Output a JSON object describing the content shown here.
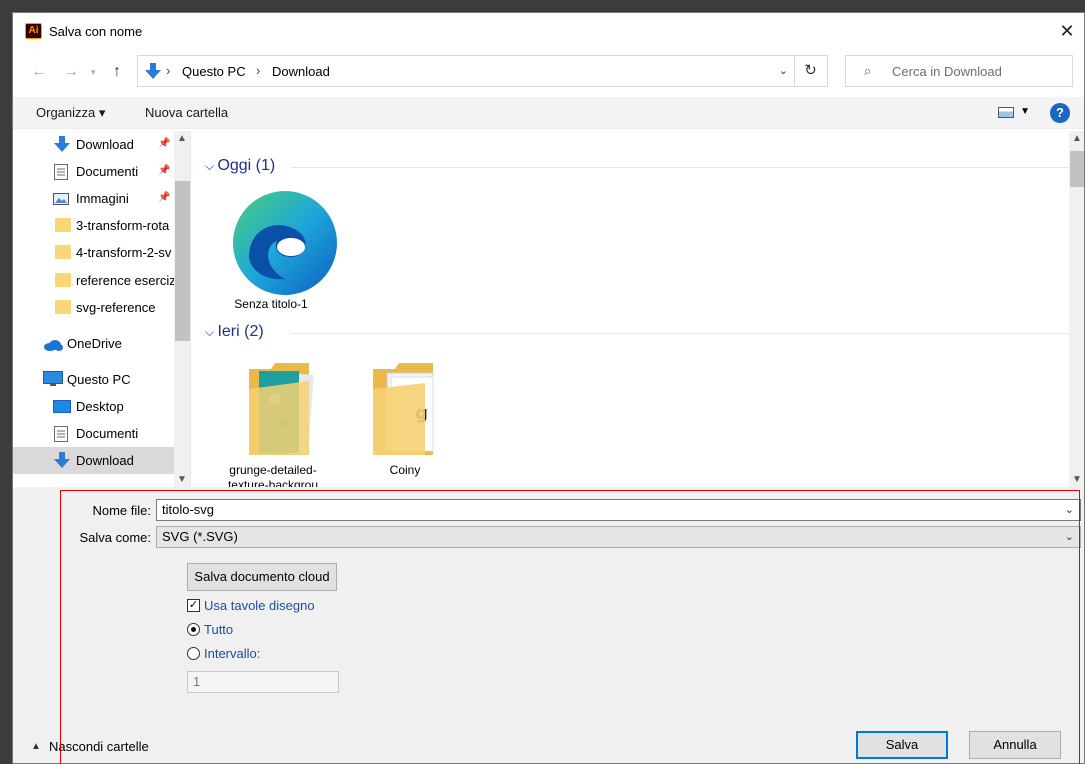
{
  "window": {
    "app_logo": "Ai",
    "title": "Salva con nome",
    "close_symbol": "✕"
  },
  "address": {
    "crumbs": [
      "Questo PC",
      "Download"
    ],
    "search_placeholder": "Cerca in Download"
  },
  "toolbar": {
    "organize": "Organizza ▾",
    "new_folder": "Nuova cartella",
    "help_symbol": "?"
  },
  "sidebar": {
    "items": [
      {
        "label": "Download",
        "icon": "download-arrow-icon",
        "pinned": true
      },
      {
        "label": "Documenti",
        "icon": "document-icon",
        "pinned": true
      },
      {
        "label": "Immagini",
        "icon": "pictures-icon",
        "pinned": true
      },
      {
        "label": "3-transform-rota",
        "icon": "folder-icon"
      },
      {
        "label": "4-transform-2-sv",
        "icon": "folder-icon"
      },
      {
        "label": "reference esercizi",
        "icon": "folder-icon"
      },
      {
        "label": "svg-reference",
        "icon": "folder-icon"
      },
      {
        "label": "OneDrive",
        "icon": "cloud-icon"
      },
      {
        "label": "Questo PC",
        "icon": "computer-icon"
      },
      {
        "label": "Desktop",
        "icon": "desktop-icon"
      },
      {
        "label": "Documenti",
        "icon": "document-icon"
      },
      {
        "label": "Download",
        "icon": "download-arrow-icon",
        "selected": true
      }
    ]
  },
  "content": {
    "groups": [
      {
        "header": "Oggi (1)",
        "files": [
          {
            "name": "Senza titolo-1",
            "icon": "edge-icon"
          }
        ]
      },
      {
        "header": "Ieri (2)",
        "files": [
          {
            "name": "grunge-detailed-texture-backgrou",
            "icon": "folder-icon"
          },
          {
            "name": "Coiny",
            "icon": "folder-icon"
          }
        ]
      }
    ]
  },
  "form": {
    "filename_label": "Nome file:",
    "filename_value": "titolo-svg",
    "saveas_label": "Salva come:",
    "saveas_value": "SVG (*.SVG)",
    "cloud_button": "Salva documento cloud",
    "use_artboards_label": "Usa tavole disegno",
    "use_artboards_checked": true,
    "all_label": "Tutto",
    "range_label": "Intervallo:",
    "range_value": "1",
    "hide_folders": "Nascondi cartelle",
    "save_button": "Salva",
    "cancel_button": "Annulla"
  },
  "colors": {
    "accent": "#0078d7",
    "link_blue": "#1a4fa0",
    "folder_yellow": "#f8d775",
    "annotation_red": "#e00000"
  }
}
